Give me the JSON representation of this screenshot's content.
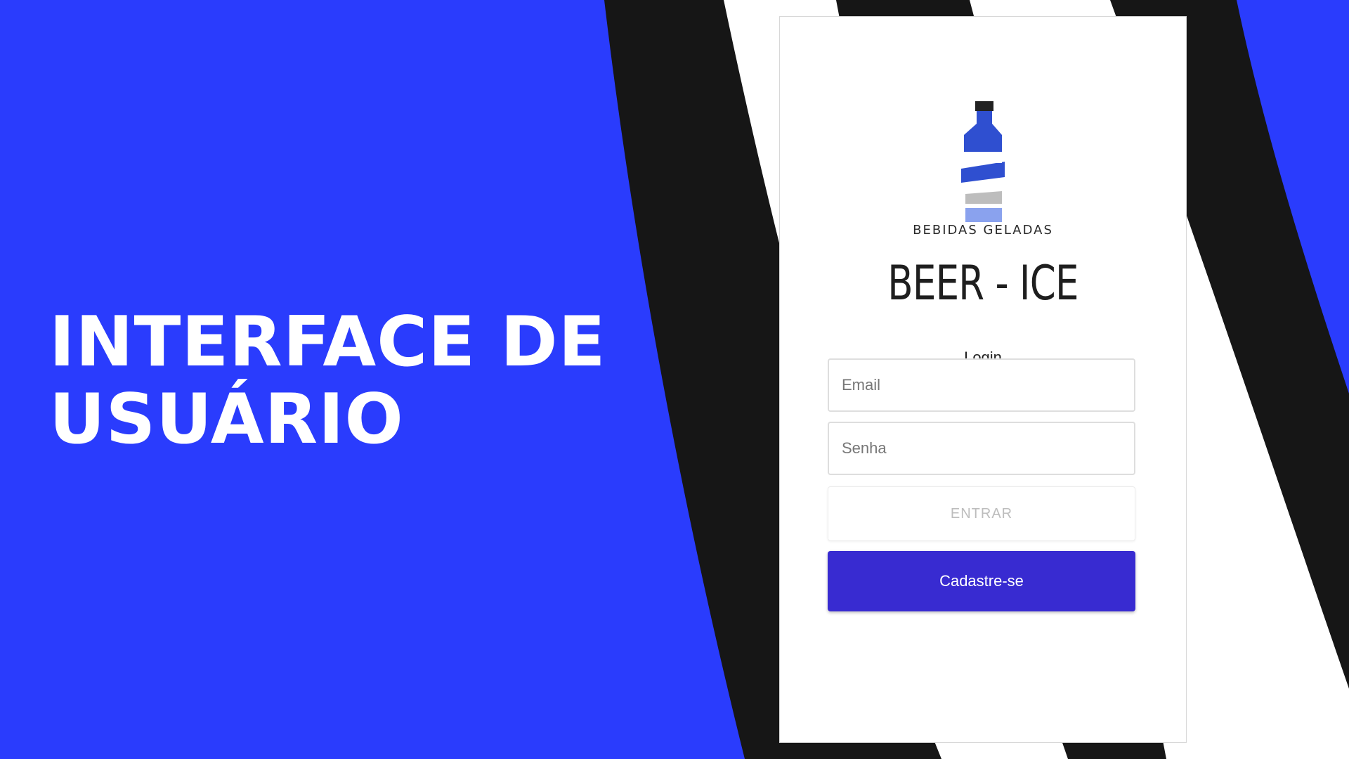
{
  "slide": {
    "headline_line1": "INTERFACE DE",
    "headline_line2": "USUÁRIO"
  },
  "app": {
    "logo_icon": "bottle-icon",
    "brand_subtitle": "BEBIDAS GELADAS",
    "brand_title": "BEER - ICE",
    "form_title": "Login",
    "email_placeholder": "Email",
    "password_placeholder": "Senha",
    "enter_label": "ENTRAR",
    "signup_label": "Cadastre-se"
  },
  "colors": {
    "background_blue": "#2a3cfd",
    "stripe_black": "#161616",
    "signup_button": "#382bd1",
    "logo_blue": "#2f4fd0",
    "logo_light_blue": "#8aa2ee",
    "logo_gray": "#bdbdbd"
  }
}
